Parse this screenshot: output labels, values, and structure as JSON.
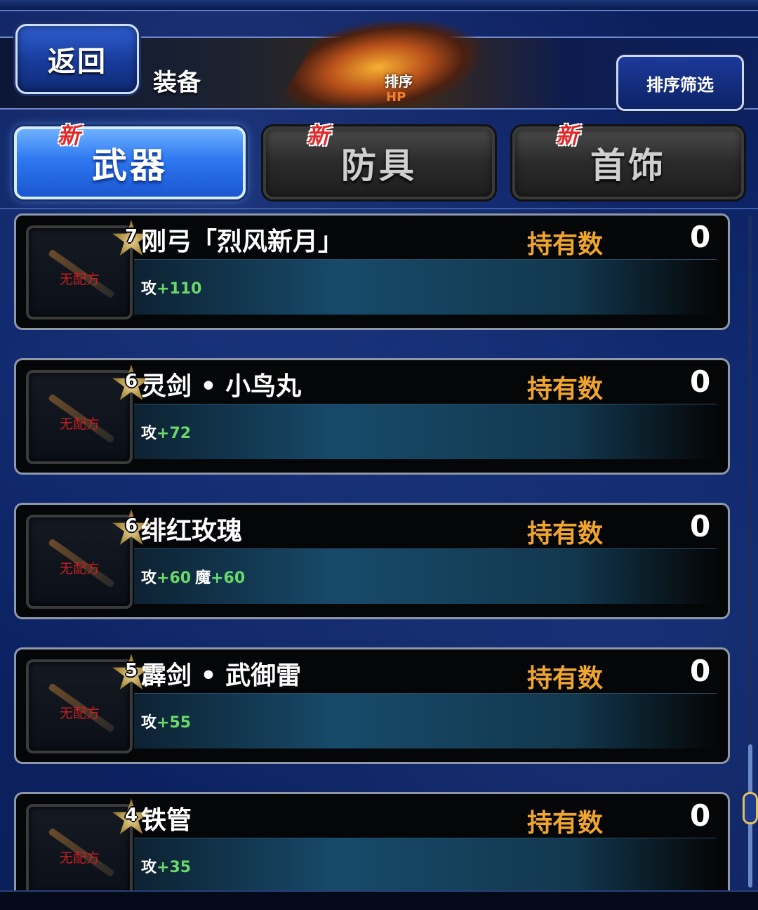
{
  "header": {
    "back_label": "返回",
    "title": "装备",
    "sort_badge_line1": "排序",
    "sort_badge_line2": "HP",
    "sort_filter_label": "排序筛选"
  },
  "tabs": [
    {
      "label": "武器",
      "new_mark": "新",
      "active": true
    },
    {
      "label": "防具",
      "new_mark": "新",
      "active": false
    },
    {
      "label": "首饰",
      "new_mark": "新",
      "active": false
    }
  ],
  "items": [
    {
      "rarity": "7",
      "name": "刚弓「烈风新月」",
      "no_recipe": "无配方",
      "owned_label": "持有数",
      "owned_count": "0",
      "stats": [
        {
          "key": "攻",
          "value": "+110"
        }
      ]
    },
    {
      "rarity": "6",
      "name": "灵剑 • 小鸟丸",
      "no_recipe": "无配方",
      "owned_label": "持有数",
      "owned_count": "0",
      "stats": [
        {
          "key": "攻",
          "value": "+72"
        }
      ]
    },
    {
      "rarity": "6",
      "name": "绯红玫瑰",
      "no_recipe": "无配方",
      "owned_label": "持有数",
      "owned_count": "0",
      "stats": [
        {
          "key": "攻",
          "value": "+60"
        },
        {
          "key": "魔",
          "value": "+60"
        }
      ]
    },
    {
      "rarity": "5",
      "name": "霹剑 • 武御雷",
      "no_recipe": "无配方",
      "owned_label": "持有数",
      "owned_count": "0",
      "stats": [
        {
          "key": "攻",
          "value": "+55"
        }
      ]
    },
    {
      "rarity": "4",
      "name": "铁管",
      "no_recipe": "无配方",
      "owned_label": "持有数",
      "owned_count": "0",
      "stats": [
        {
          "key": "攻",
          "value": "+35"
        }
      ]
    }
  ],
  "colors": {
    "owned_label": "#f0a52e",
    "stat_value": "#6ad86a",
    "no_recipe": "#c82020",
    "new_mark": "#e02a2a",
    "active_tab": "#2e78f0"
  }
}
